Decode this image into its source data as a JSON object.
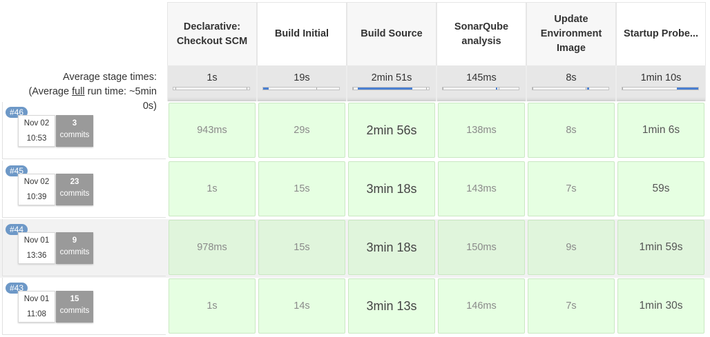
{
  "stages": [
    {
      "name": "Declarative: Checkout SCM",
      "avg": "1s",
      "bar_fill": 0.0
    },
    {
      "name": "Build Initial",
      "avg": "19s",
      "bar_fill": 0.07
    },
    {
      "name": "Build Source",
      "avg": "2min 51s",
      "bar_fill": 0.72
    },
    {
      "name": "SonarQube analysis",
      "avg": "145ms",
      "bar_fill": 0.0
    },
    {
      "name": "Update Environment Image",
      "avg": "8s",
      "bar_fill": 0.03
    },
    {
      "name": "Startup Probe...",
      "avg": "1min 10s",
      "bar_fill": 0.28
    }
  ],
  "summary": {
    "avg_stage_label": "Average stage times:",
    "avg_full_prefix": "(Average ",
    "avg_full_word": "full",
    "avg_full_suffix": " run time: ~5min",
    "avg_full_line2": "0s)"
  },
  "builds": [
    {
      "number": "#46",
      "date": "Nov 02",
      "time": "10:53",
      "commits": "3",
      "commits_label": "commits",
      "durations": [
        "943ms",
        "29s",
        "2min 56s",
        "138ms",
        "8s",
        "1min 6s"
      ]
    },
    {
      "number": "#45",
      "date": "Nov 02",
      "time": "10:39",
      "commits": "23",
      "commits_label": "commits",
      "durations": [
        "1s",
        "15s",
        "3min 18s",
        "143ms",
        "7s",
        "59s"
      ]
    },
    {
      "number": "#44",
      "date": "Nov 01",
      "time": "13:36",
      "commits": "9",
      "commits_label": "commits",
      "durations": [
        "978ms",
        "15s",
        "3min 18s",
        "150ms",
        "9s",
        "1min 59s"
      ]
    },
    {
      "number": "#43",
      "date": "Nov 01",
      "time": "11:08",
      "commits": "15",
      "commits_label": "commits",
      "durations": [
        "1s",
        "14s",
        "3min 13s",
        "146ms",
        "7s",
        "1min 30s"
      ]
    }
  ],
  "colors": {
    "success_cell": "#e6ffe2",
    "success_cell_hover": "#e0f5dc",
    "badge": "#6d98c7",
    "progress": "#4a7fd1",
    "commit_box": "#9a9a9a"
  }
}
